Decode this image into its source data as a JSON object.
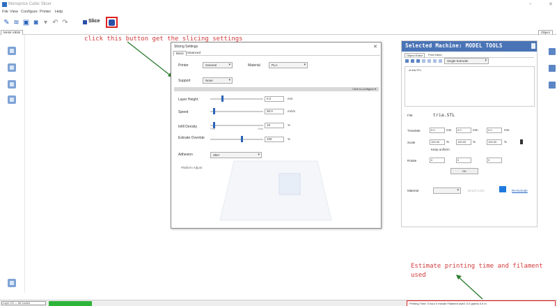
{
  "window": {
    "title": "Monoprice Cubic Slicer"
  },
  "menu": [
    "File",
    "View",
    "Configure",
    "Printer",
    "Help"
  ],
  "toolbar": {
    "slice_label": "Slice"
  },
  "tabs": {
    "main": "MAIN VIEW",
    "right": "Object"
  },
  "annotations": {
    "top": "click this button get the slicing settings",
    "bottom_line1": "Estimate printing time and filament",
    "bottom_line2": "used"
  },
  "dialog": {
    "title": "Slicing Settings",
    "tabs": [
      "Basic",
      "Advanced"
    ],
    "printer_label": "Printer",
    "printer_value": "General",
    "material_label": "Material",
    "material_value": "PLA",
    "support_label": "Support",
    "support_value": "None",
    "strip_label": "Click to configure ▾",
    "layer_height_label": "Layer Height",
    "layer_height_value": "0.2",
    "layer_height_unit": "mm",
    "speed_label": "Speed",
    "speed_value": "30.0",
    "speed_unit": "mm/s",
    "infill_label": "Infill Density",
    "infill_value": "10",
    "infill_unit": "%",
    "extruder_label": "Extrude Override",
    "extruder_value": "100",
    "extruder_unit": "%",
    "adhesion_label": "Adhesion",
    "adhesion_value": "Skirt",
    "check_label": "Platform Adjust",
    "slider_lo": "Fast",
    "slider_hi": "Slow",
    "slider_levels": {
      "layer_height": 0.22,
      "speed": 0.05,
      "infill": 0.05,
      "extruder": 0.6
    }
  },
  "panel": {
    "header": "Selected Machine: MODEL TOOLS",
    "tabs": [
      "Object Editor",
      "Print Editor"
    ],
    "tool_dropdown": "Single Extruder",
    "list_item": "cf-tria.STL",
    "file_label": "File:",
    "file_value": "tria.STL",
    "transform_label": "Translate",
    "scale_label": "Scale",
    "rotate_label": "Rotate",
    "keep_ratio": "Keep uniform",
    "x1": "0.0",
    "y1": "0.0",
    "z1": "0.0",
    "sx": "100.00",
    "sy": "100.00",
    "sz": "100.00",
    "rx": "0",
    "ry": "0",
    "rz": "0",
    "unit_mm": "mm",
    "unit_pct": "%",
    "ok_button": "OK",
    "material_label": "Material",
    "brand_label": "Brand Color",
    "brand_link": "Re-Extrude"
  },
  "status": {
    "left": "Layer 0/0 — file loaded",
    "estimate": "Printing Time: 0 hour 0 minute  Filament used: 0.0 grams  0.0 m",
    "progress": 1.0
  },
  "colors": {
    "accent": "#2a62b8",
    "annotation": "#d33a3a",
    "arrow": "#2e7d32",
    "progress": "#2fb43a"
  }
}
